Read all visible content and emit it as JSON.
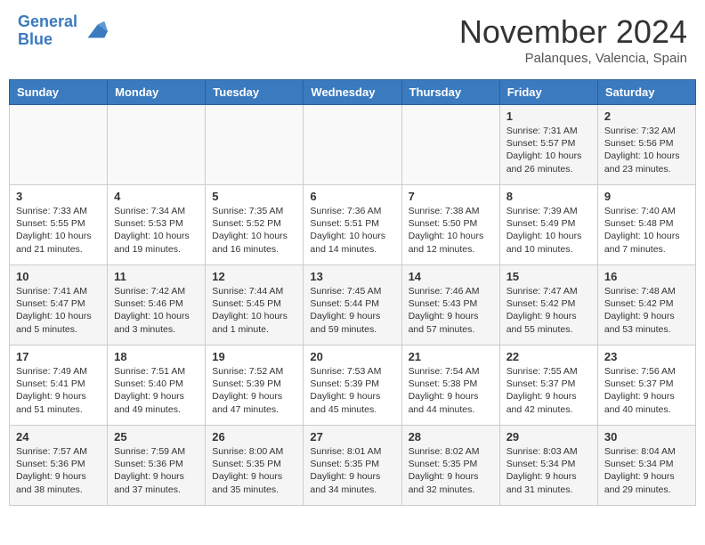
{
  "header": {
    "logo_line1": "General",
    "logo_line2": "Blue",
    "month": "November 2024",
    "location": "Palanques, Valencia, Spain"
  },
  "days_of_week": [
    "Sunday",
    "Monday",
    "Tuesday",
    "Wednesday",
    "Thursday",
    "Friday",
    "Saturday"
  ],
  "weeks": [
    [
      {
        "day": "",
        "info": ""
      },
      {
        "day": "",
        "info": ""
      },
      {
        "day": "",
        "info": ""
      },
      {
        "day": "",
        "info": ""
      },
      {
        "day": "",
        "info": ""
      },
      {
        "day": "1",
        "info": "Sunrise: 7:31 AM\nSunset: 5:57 PM\nDaylight: 10 hours and 26 minutes."
      },
      {
        "day": "2",
        "info": "Sunrise: 7:32 AM\nSunset: 5:56 PM\nDaylight: 10 hours and 23 minutes."
      }
    ],
    [
      {
        "day": "3",
        "info": "Sunrise: 7:33 AM\nSunset: 5:55 PM\nDaylight: 10 hours and 21 minutes."
      },
      {
        "day": "4",
        "info": "Sunrise: 7:34 AM\nSunset: 5:53 PM\nDaylight: 10 hours and 19 minutes."
      },
      {
        "day": "5",
        "info": "Sunrise: 7:35 AM\nSunset: 5:52 PM\nDaylight: 10 hours and 16 minutes."
      },
      {
        "day": "6",
        "info": "Sunrise: 7:36 AM\nSunset: 5:51 PM\nDaylight: 10 hours and 14 minutes."
      },
      {
        "day": "7",
        "info": "Sunrise: 7:38 AM\nSunset: 5:50 PM\nDaylight: 10 hours and 12 minutes."
      },
      {
        "day": "8",
        "info": "Sunrise: 7:39 AM\nSunset: 5:49 PM\nDaylight: 10 hours and 10 minutes."
      },
      {
        "day": "9",
        "info": "Sunrise: 7:40 AM\nSunset: 5:48 PM\nDaylight: 10 hours and 7 minutes."
      }
    ],
    [
      {
        "day": "10",
        "info": "Sunrise: 7:41 AM\nSunset: 5:47 PM\nDaylight: 10 hours and 5 minutes."
      },
      {
        "day": "11",
        "info": "Sunrise: 7:42 AM\nSunset: 5:46 PM\nDaylight: 10 hours and 3 minutes."
      },
      {
        "day": "12",
        "info": "Sunrise: 7:44 AM\nSunset: 5:45 PM\nDaylight: 10 hours and 1 minute."
      },
      {
        "day": "13",
        "info": "Sunrise: 7:45 AM\nSunset: 5:44 PM\nDaylight: 9 hours and 59 minutes."
      },
      {
        "day": "14",
        "info": "Sunrise: 7:46 AM\nSunset: 5:43 PM\nDaylight: 9 hours and 57 minutes."
      },
      {
        "day": "15",
        "info": "Sunrise: 7:47 AM\nSunset: 5:42 PM\nDaylight: 9 hours and 55 minutes."
      },
      {
        "day": "16",
        "info": "Sunrise: 7:48 AM\nSunset: 5:42 PM\nDaylight: 9 hours and 53 minutes."
      }
    ],
    [
      {
        "day": "17",
        "info": "Sunrise: 7:49 AM\nSunset: 5:41 PM\nDaylight: 9 hours and 51 minutes."
      },
      {
        "day": "18",
        "info": "Sunrise: 7:51 AM\nSunset: 5:40 PM\nDaylight: 9 hours and 49 minutes."
      },
      {
        "day": "19",
        "info": "Sunrise: 7:52 AM\nSunset: 5:39 PM\nDaylight: 9 hours and 47 minutes."
      },
      {
        "day": "20",
        "info": "Sunrise: 7:53 AM\nSunset: 5:39 PM\nDaylight: 9 hours and 45 minutes."
      },
      {
        "day": "21",
        "info": "Sunrise: 7:54 AM\nSunset: 5:38 PM\nDaylight: 9 hours and 44 minutes."
      },
      {
        "day": "22",
        "info": "Sunrise: 7:55 AM\nSunset: 5:37 PM\nDaylight: 9 hours and 42 minutes."
      },
      {
        "day": "23",
        "info": "Sunrise: 7:56 AM\nSunset: 5:37 PM\nDaylight: 9 hours and 40 minutes."
      }
    ],
    [
      {
        "day": "24",
        "info": "Sunrise: 7:57 AM\nSunset: 5:36 PM\nDaylight: 9 hours and 38 minutes."
      },
      {
        "day": "25",
        "info": "Sunrise: 7:59 AM\nSunset: 5:36 PM\nDaylight: 9 hours and 37 minutes."
      },
      {
        "day": "26",
        "info": "Sunrise: 8:00 AM\nSunset: 5:35 PM\nDaylight: 9 hours and 35 minutes."
      },
      {
        "day": "27",
        "info": "Sunrise: 8:01 AM\nSunset: 5:35 PM\nDaylight: 9 hours and 34 minutes."
      },
      {
        "day": "28",
        "info": "Sunrise: 8:02 AM\nSunset: 5:35 PM\nDaylight: 9 hours and 32 minutes."
      },
      {
        "day": "29",
        "info": "Sunrise: 8:03 AM\nSunset: 5:34 PM\nDaylight: 9 hours and 31 minutes."
      },
      {
        "day": "30",
        "info": "Sunrise: 8:04 AM\nSunset: 5:34 PM\nDaylight: 9 hours and 29 minutes."
      }
    ]
  ]
}
